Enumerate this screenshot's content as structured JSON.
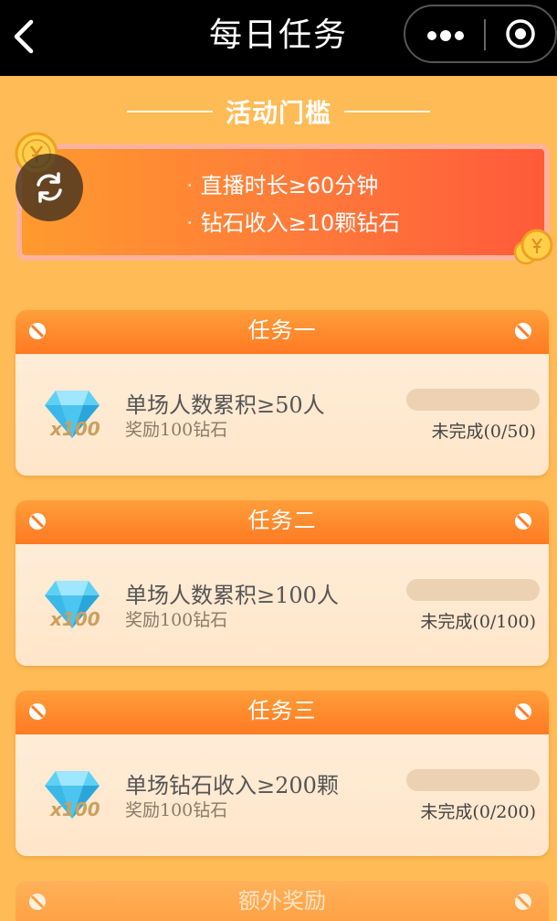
{
  "topbar": {
    "title": "每日任务"
  },
  "threshold": {
    "section_title": "活动门槛",
    "items": [
      "直播时长≥60分钟",
      "钻石收入≥10颗钻石"
    ]
  },
  "tasks": [
    {
      "header": "任务一",
      "name": "单场人数累积≥50人",
      "reward": "奖励100钻石",
      "diamond_qty": "x100",
      "status": "未完成(0/50)",
      "progress": 0
    },
    {
      "header": "任务二",
      "name": "单场人数累积≥100人",
      "reward": "奖励100钻石",
      "diamond_qty": "x100",
      "status": "未完成(0/100)",
      "progress": 0
    },
    {
      "header": "任务三",
      "name": "单场钻石收入≥200颗",
      "reward": "奖励100钻石",
      "diamond_qty": "x100",
      "status": "未完成(0/200)",
      "progress": 0
    }
  ],
  "extra": {
    "header": "额外奖励"
  },
  "icons": {
    "back": "chevron-left-icon",
    "more": "more-dots-icon",
    "close": "target-close-icon",
    "refresh": "refresh-icon",
    "coin": "coin-icon",
    "screw": "screw-icon",
    "diamond": "diamond-icon"
  },
  "colors": {
    "background": "#ffbb55",
    "header_orange": "#ff7a22",
    "card_bg": "#ffeedd",
    "threshold_gradient_start": "#ff9a2e",
    "threshold_gradient_end": "#ff5a3a",
    "progress_track": "#ecd2b2"
  }
}
